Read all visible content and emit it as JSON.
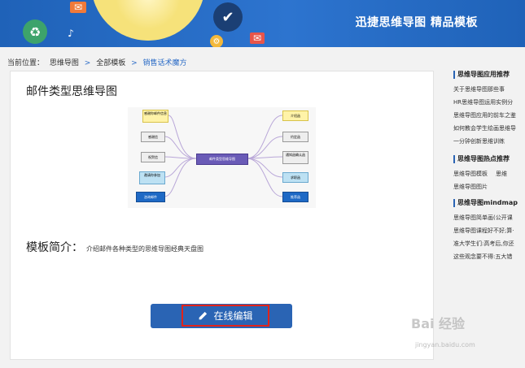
{
  "banner": {
    "title": "迅捷思维导图 精品模板",
    "bg_color": "#2466be",
    "decor_icons": [
      "envelope-icon",
      "recycle-icon",
      "music-note-icon",
      "lightbulb-icon",
      "check-circle-icon",
      "gear-icon",
      "envelope-icon"
    ]
  },
  "breadcrumb": {
    "prefix": "当前位置：",
    "items": [
      "思维导图",
      "全部模板",
      "销售话术魔方"
    ],
    "separator": ">",
    "link_color": "#2a6bc6"
  },
  "template": {
    "title": "邮件类型思维导图",
    "mindmap": {
      "center": "邮件类型思维导图",
      "left_nodes": [
        "感谢你邮件信息",
        "感谢信",
        "祝贺信",
        "邀请你参加",
        "咨询邮件"
      ],
      "right_nodes": [
        "介绍函",
        "约定函",
        "通知函确认函",
        "求职函",
        "推荐函"
      ]
    },
    "intro_label": "模板简介：",
    "intro_text": "介绍邮件各种类型的思维导图经典天盘图",
    "edit_button_label": "在线编辑",
    "edit_button_color": "#2a64b4",
    "highlight_color": "#e2231a"
  },
  "sidebar": {
    "section1_title": "思维导图应用推荐",
    "section1_items": [
      "关于思维导图那些事",
      "HR思维导图运用实例分",
      "思维导图应用的前车之鉴",
      "如何教会学生绘画思维导",
      "一分钟创新思维训练"
    ],
    "section2_title": "思维导图热点推荐",
    "section2_items": [
      "思维导图模板",
      "思维",
      "思维导图图片"
    ],
    "section3_title": "思维导图mindmap",
    "section3_items": [
      "思维导图简单画(公开课",
      "思维导图课程好不好;算·",
      "准大学生们:高考后,你还",
      "这些观念要不得:五大错"
    ]
  },
  "watermark": {
    "text": "Bai 经验",
    "url": "jingyan.baidu.com"
  }
}
